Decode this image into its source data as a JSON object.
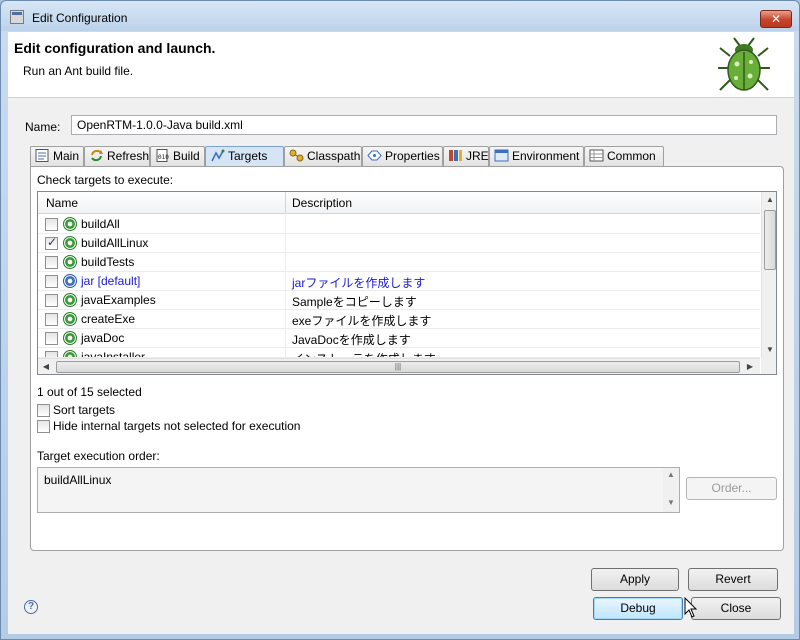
{
  "window": {
    "title": "Edit Configuration",
    "close_glyph": "✕"
  },
  "header": {
    "title": "Edit configuration and launch.",
    "subtitle": "Run an Ant build file."
  },
  "name": {
    "label": "Name:",
    "value": "OpenRTM-1.0.0-Java build.xml"
  },
  "tabs": [
    {
      "label": "Main",
      "icon": "main-tab-icon"
    },
    {
      "label": "Refresh",
      "icon": "refresh-icon"
    },
    {
      "label": "Build",
      "icon": "build-icon"
    },
    {
      "label": "Targets",
      "icon": "targets-icon",
      "active": true
    },
    {
      "label": "Classpath",
      "icon": "classpath-icon"
    },
    {
      "label": "Properties",
      "icon": "properties-icon"
    },
    {
      "label": "JRE",
      "icon": "jre-icon"
    },
    {
      "label": "Environment",
      "icon": "environment-icon"
    },
    {
      "label": "Common",
      "icon": "common-icon"
    }
  ],
  "targets": {
    "prompt": "Check targets to execute:",
    "columns": [
      "Name",
      "Description"
    ],
    "rows": [
      {
        "name": "buildAll",
        "description": "",
        "checked": false,
        "default": false
      },
      {
        "name": "buildAllLinux",
        "description": "",
        "checked": true,
        "default": false
      },
      {
        "name": "buildTests",
        "description": "",
        "checked": false,
        "default": false
      },
      {
        "name": "jar [default]",
        "description": "jarファイルを作成します",
        "checked": false,
        "default": true
      },
      {
        "name": "javaExamples",
        "description": "Sampleをコピーします",
        "checked": false,
        "default": false
      },
      {
        "name": "createExe",
        "description": "exeファイルを作成します",
        "checked": false,
        "default": false
      },
      {
        "name": "javaDoc",
        "description": "JavaDocを作成します",
        "checked": false,
        "default": false
      },
      {
        "name": "javaInstaller",
        "description": "インストーラを作成します",
        "checked": false,
        "default": false
      }
    ],
    "selected_count": "1 out of 15 selected",
    "sort_label": "Sort targets",
    "hide_label": "Hide internal targets not selected for execution",
    "order_label": "Target execution order:",
    "order_value": "buildAllLinux",
    "order_button": "Order..."
  },
  "buttons": {
    "apply": "Apply",
    "revert": "Revert",
    "debug": "Debug",
    "close": "Close"
  },
  "help_glyph": "?"
}
